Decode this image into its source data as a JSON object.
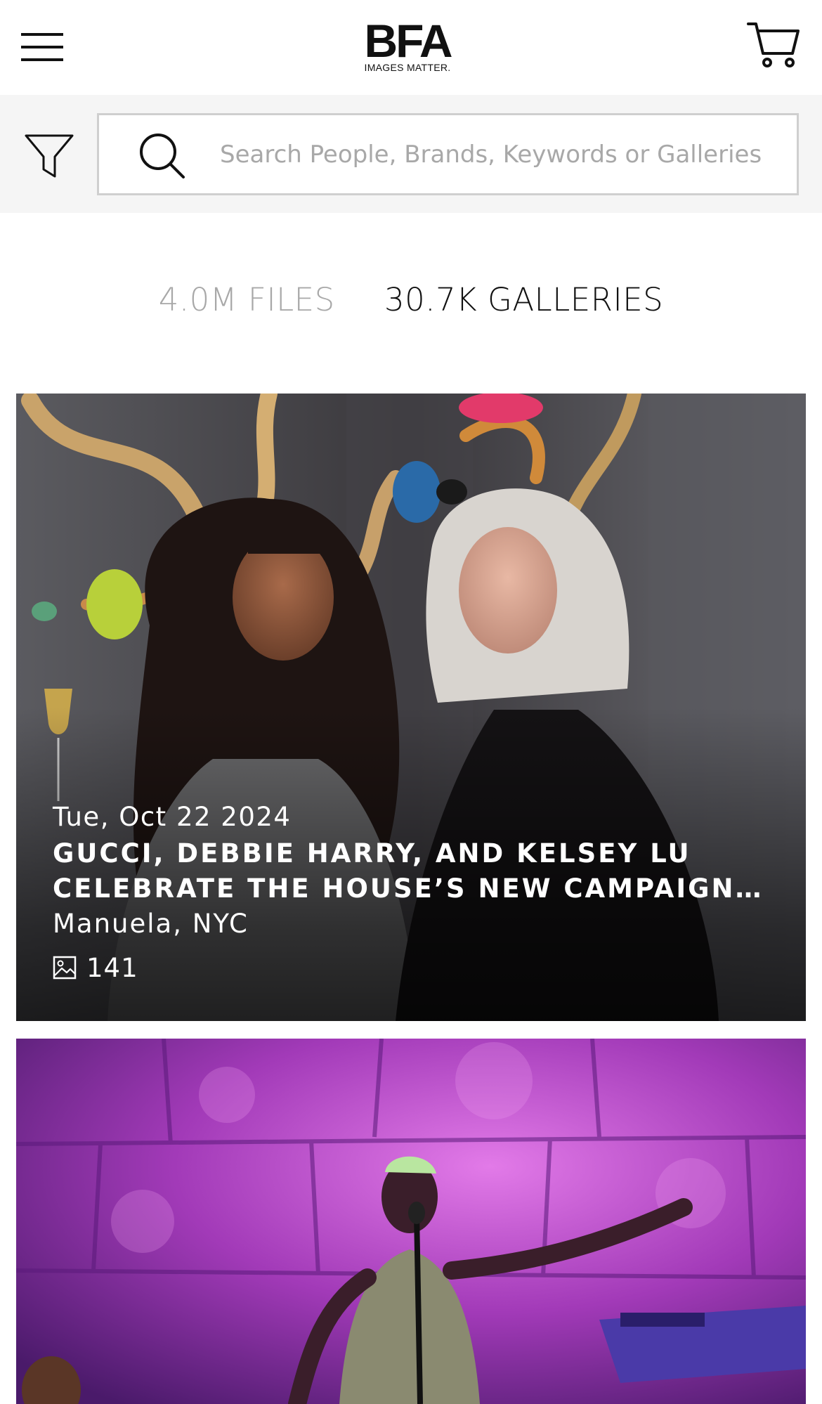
{
  "header": {
    "logo_text": "BFA",
    "logo_tagline": "IMAGES MATTER.",
    "menu_icon": "hamburger-menu-icon",
    "cart_icon": "shopping-cart-icon"
  },
  "search": {
    "placeholder": "Search People, Brands, Keywords or Galleries",
    "value": "",
    "search_icon": "search-icon",
    "filter_icon": "filter-icon"
  },
  "stats": {
    "files_label": "4.0M FILES",
    "galleries_label": "30.7K GALLERIES",
    "active_tab": "galleries"
  },
  "galleries": [
    {
      "date": "Tue, Oct 22 2024",
      "title": "GUCCI, DEBBIE HARRY, AND KELSEY LU CELEBRATE THE HOUSE’S NEW CAMPAIGN WITH AN INTIMATE DINNER",
      "location": "Manuela, NYC",
      "image_count": "141",
      "count_icon": "image-icon"
    },
    {
      "date": "",
      "title": "",
      "location": "",
      "image_count": ""
    }
  ],
  "colors": {
    "text_primary": "#111111",
    "text_muted": "#a8a8a8",
    "search_strip_bg": "#f5f5f5",
    "search_border": "#cfcfcf"
  }
}
